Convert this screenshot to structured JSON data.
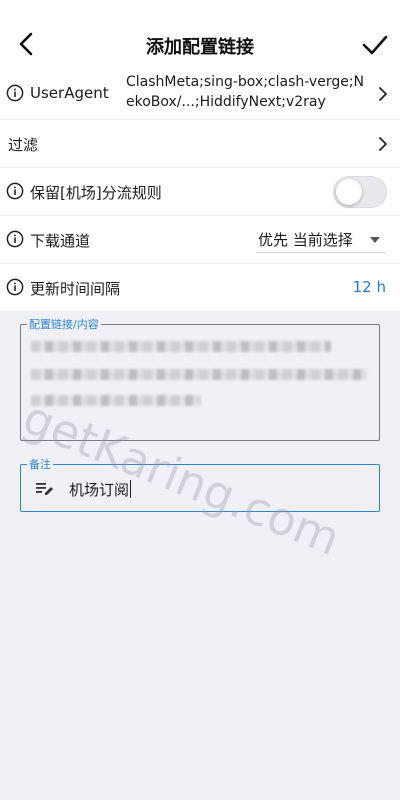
{
  "appbar": {
    "title": "添加配置链接",
    "back_icon": "arrow-back-icon",
    "confirm_icon": "check-icon"
  },
  "settings": {
    "user_agent": {
      "label": "UserAgent",
      "value": "ClashMeta;sing-box;clash-verge;NekoBox/...;HiddifyNext;v2ray"
    },
    "filter": {
      "label": "过滤"
    },
    "keep_rules": {
      "label": "保留[机场]分流规则",
      "enabled": false
    },
    "download_channel": {
      "label": "下载通道",
      "value": "优先 当前选择"
    },
    "update_interval": {
      "label": "更新时间间隔",
      "value": "12 h"
    }
  },
  "link_field": {
    "label": "配置链接/内容",
    "value_redacted": true
  },
  "note_field": {
    "label": "备注",
    "value": "机场订阅"
  },
  "watermark": "getKaring.com",
  "colors": {
    "accent": "#2a86d9",
    "background": "#f1f0f6",
    "surface": "#ffffff"
  }
}
